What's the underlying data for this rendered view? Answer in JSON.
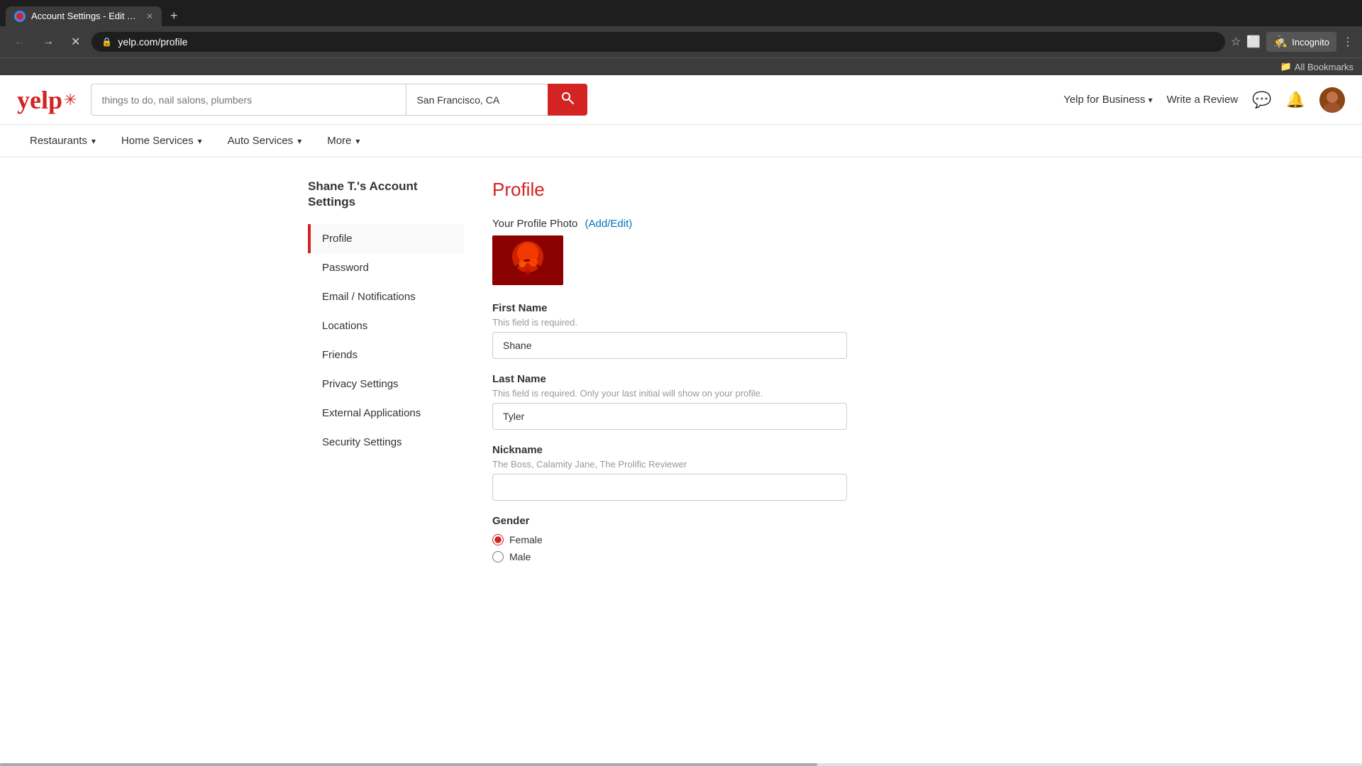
{
  "browser": {
    "tab_title": "Account Settings - Edit Your Pr...",
    "tab_favicon": "yelp",
    "address": "yelp.com/profile",
    "incognito_label": "Incognito",
    "bookmarks_label": "All Bookmarks",
    "loading": true
  },
  "header": {
    "logo": "yelp",
    "search_placeholder": "things to do, nail salons, plumbers",
    "location_value": "San Francisco, CA",
    "search_btn_label": "🔍",
    "yelp_for_business": "Yelp for Business",
    "write_review": "Write a Review"
  },
  "nav": {
    "items": [
      {
        "label": "Restaurants",
        "chevron": true
      },
      {
        "label": "Home Services",
        "chevron": true
      },
      {
        "label": "Auto Services",
        "chevron": true
      },
      {
        "label": "More",
        "chevron": true
      }
    ]
  },
  "sidebar": {
    "account_title": "Shane T.'s Account Settings",
    "items": [
      {
        "label": "Profile",
        "active": true,
        "id": "profile"
      },
      {
        "label": "Password",
        "active": false,
        "id": "password"
      },
      {
        "label": "Email / Notifications",
        "active": false,
        "id": "email-notifications"
      },
      {
        "label": "Locations",
        "active": false,
        "id": "locations"
      },
      {
        "label": "Friends",
        "active": false,
        "id": "friends"
      },
      {
        "label": "Privacy Settings",
        "active": false,
        "id": "privacy-settings"
      },
      {
        "label": "External Applications",
        "active": false,
        "id": "external-applications"
      },
      {
        "label": "Security Settings",
        "active": false,
        "id": "security-settings"
      }
    ]
  },
  "profile": {
    "title": "Profile",
    "photo_label": "Your Profile Photo",
    "photo_edit_link": "(Add/Edit)",
    "first_name_label": "First Name",
    "first_name_hint": "This field is required.",
    "first_name_value": "Shane",
    "last_name_label": "Last Name",
    "last_name_hint": "This field is required.  Only your last initial will show on your profile.",
    "last_name_value": "Tyler",
    "nickname_label": "Nickname",
    "nickname_placeholder": "The Boss, Calamity Jane, The Prolific Reviewer",
    "nickname_value": "",
    "gender_label": "Gender",
    "gender_options": [
      {
        "label": "Female",
        "value": "female",
        "checked": true
      },
      {
        "label": "Male",
        "value": "male",
        "checked": false
      }
    ]
  }
}
